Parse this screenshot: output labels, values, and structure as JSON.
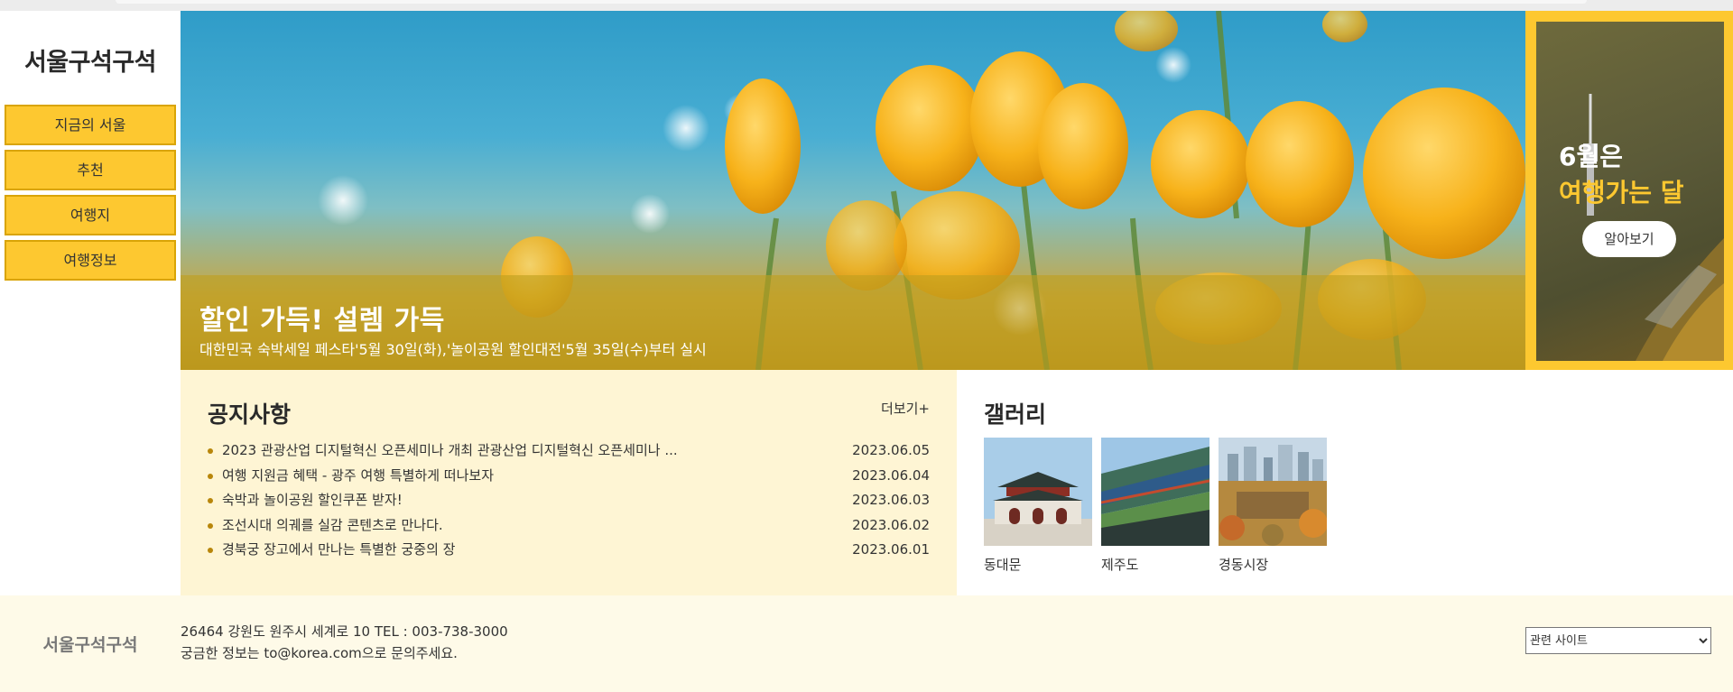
{
  "site": {
    "logo": "서울구석구석",
    "accent_color": "#fdc830"
  },
  "sidebar": {
    "items": [
      {
        "label": "지금의 서울"
      },
      {
        "label": "추천"
      },
      {
        "label": "여행지"
      },
      {
        "label": "여행정보"
      }
    ]
  },
  "hero": {
    "title": "할인 가득! 설렘 가득",
    "subtitle": "대한민국 숙박세일 페스타'5월 30일(화),'놀이공원 할인대전'5월 35일(수)부터 실시",
    "image": "yellow-flowers-photo"
  },
  "banner": {
    "title_line1": "6월은",
    "title_line2": "여행가는 달",
    "button_label": "알아보기",
    "image": "seoul-tower-city-wall-photo"
  },
  "notice": {
    "title": "공지사항",
    "more_label": "더보기+",
    "items": [
      {
        "text": "2023 관광산업 디지털혁신 오픈세미나 개최 관광산업 디지털혁신 오픈세미나 ...",
        "date": "2023.06.05"
      },
      {
        "text": "여행 지원금 혜택 - 광주 여행 특별하게 떠나보자",
        "date": "2023.06.04"
      },
      {
        "text": "숙박과 놀이공원 할인쿠폰 받자!",
        "date": "2023.06.03"
      },
      {
        "text": "조선시대 의궤를 실감 콘텐츠로 만나다.",
        "date": "2023.06.02"
      },
      {
        "text": "경북궁 장고에서 만나는 특별한 궁중의 장",
        "date": "2023.06.01"
      }
    ]
  },
  "gallery": {
    "title": "갤러리",
    "items": [
      {
        "label": "동대문",
        "image": "palace-gate-photo"
      },
      {
        "label": "제주도",
        "image": "palace-eaves-photo"
      },
      {
        "label": "경동시장",
        "image": "city-skyline-photo"
      }
    ]
  },
  "footer": {
    "logo": "서울구석구석",
    "address": "26464 강원도 원주시 세계로 10 TEL : 003-738-3000",
    "contact": "궁금한 정보는 to@korea.com으로 문의주세요.",
    "select_value": "관련 사이트"
  }
}
